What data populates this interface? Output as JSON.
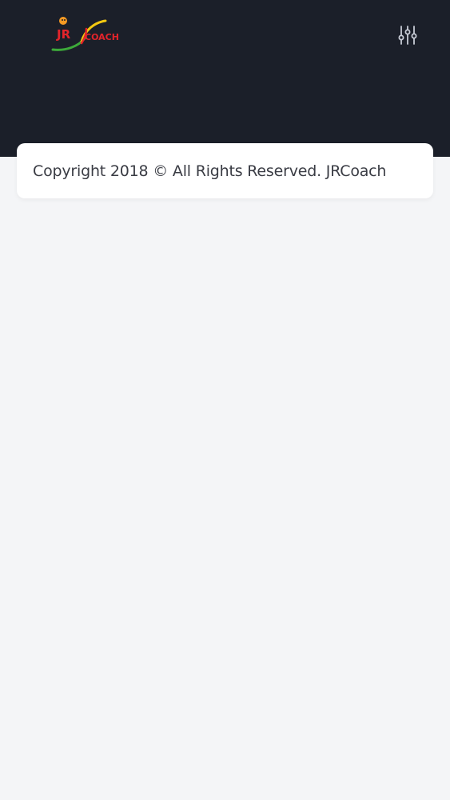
{
  "header": {
    "logo": {
      "alt": "JRCoach logo",
      "text_part1": "JR",
      "text_part2": "COACH",
      "colors": {
        "red": "#e3242b",
        "green": "#3daa3a",
        "yellow": "#f2c811",
        "orange": "#f59a23"
      }
    },
    "menu_icon": "sliders-icon",
    "background_color": "#1b1f29"
  },
  "footer": {
    "copyright": "Copyright 2018 © All Rights Reserved. JRCoach"
  }
}
